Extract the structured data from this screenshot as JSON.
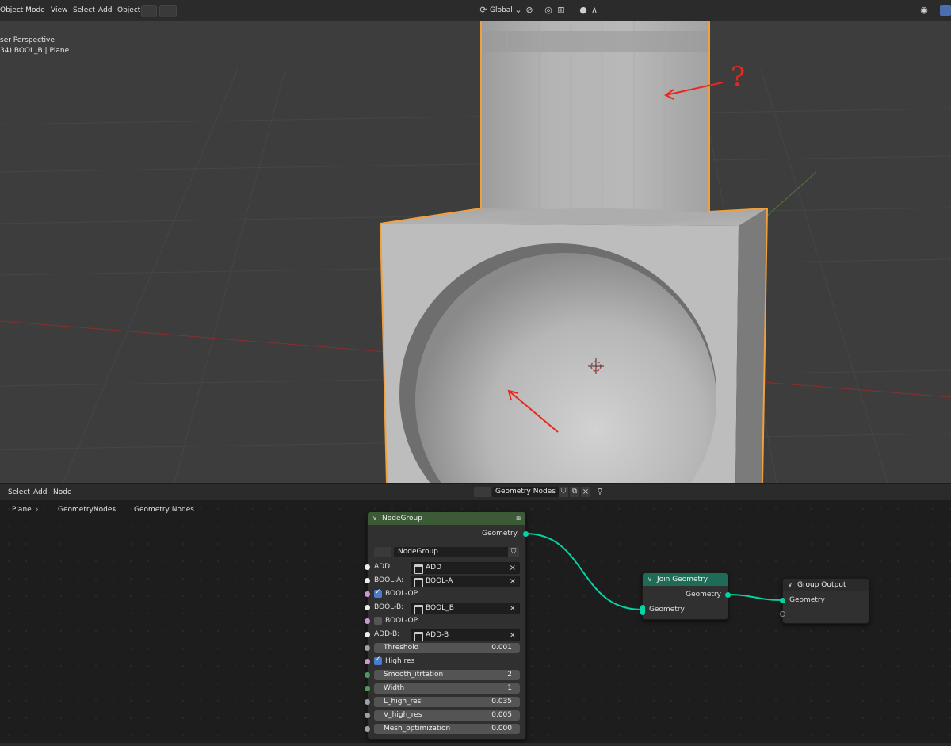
{
  "viewport_header": {
    "mode": "Object Mode",
    "menus": [
      "View",
      "Select",
      "Add",
      "Object"
    ],
    "transform_orientation": "Global"
  },
  "viewport": {
    "view_name": "ser Perspective",
    "object_info": "34) BOOL_B | Plane",
    "annotation_question": "?"
  },
  "node_editor_header": {
    "menus": [
      "Select",
      "Add",
      "Node"
    ],
    "tree_name": "Geometry Nodes"
  },
  "breadcrumb": {
    "items": [
      "Plane",
      "GeometryNodes",
      "Geometry Nodes"
    ]
  },
  "node_group": {
    "title": "NodeGroup",
    "output_label": "Geometry",
    "group_field": "NodeGroup",
    "inputs": [
      {
        "label": "ADD:",
        "kind": "object",
        "value": "ADD"
      },
      {
        "label": "BOOL-A:",
        "kind": "object",
        "value": "BOOL-A"
      },
      {
        "label": "BOOL-OP",
        "kind": "bool",
        "checked": true
      },
      {
        "label": "BOOL-B:",
        "kind": "object",
        "value": "BOOL_B"
      },
      {
        "label": "BOOL-OP",
        "kind": "bool",
        "checked": false
      },
      {
        "label": "ADD-B:",
        "kind": "object",
        "value": "ADD-B"
      },
      {
        "label": "Threshold",
        "kind": "float",
        "value": "0.001"
      },
      {
        "label": "High res",
        "kind": "bool",
        "checked": true
      },
      {
        "label": "Smooth_itrtation",
        "kind": "int",
        "value": "2"
      },
      {
        "label": "Width",
        "kind": "int",
        "value": "1"
      },
      {
        "label": "L_high_res",
        "kind": "float",
        "value": "0.035"
      },
      {
        "label": "V_high_res",
        "kind": "float",
        "value": "0.005"
      },
      {
        "label": "Mesh_optimization",
        "kind": "float",
        "value": "0.000"
      }
    ]
  },
  "join_geometry": {
    "title": "Join Geometry",
    "output_label": "Geometry",
    "input_label": "Geometry"
  },
  "group_output": {
    "title": "Group Output",
    "input_label": "Geometry"
  },
  "colors": {
    "geometry_socket": "#00d6a3",
    "object_socket": "#ededed",
    "bool_socket": "#cc99cc",
    "float_socket": "#a1a1a1",
    "int_socket": "#4d9a5c",
    "node_group_header": "#3b5a35",
    "join_geometry_header": "#1e6b58",
    "selection_outline": "#f0a040",
    "annotation_red": "#e8281e"
  }
}
